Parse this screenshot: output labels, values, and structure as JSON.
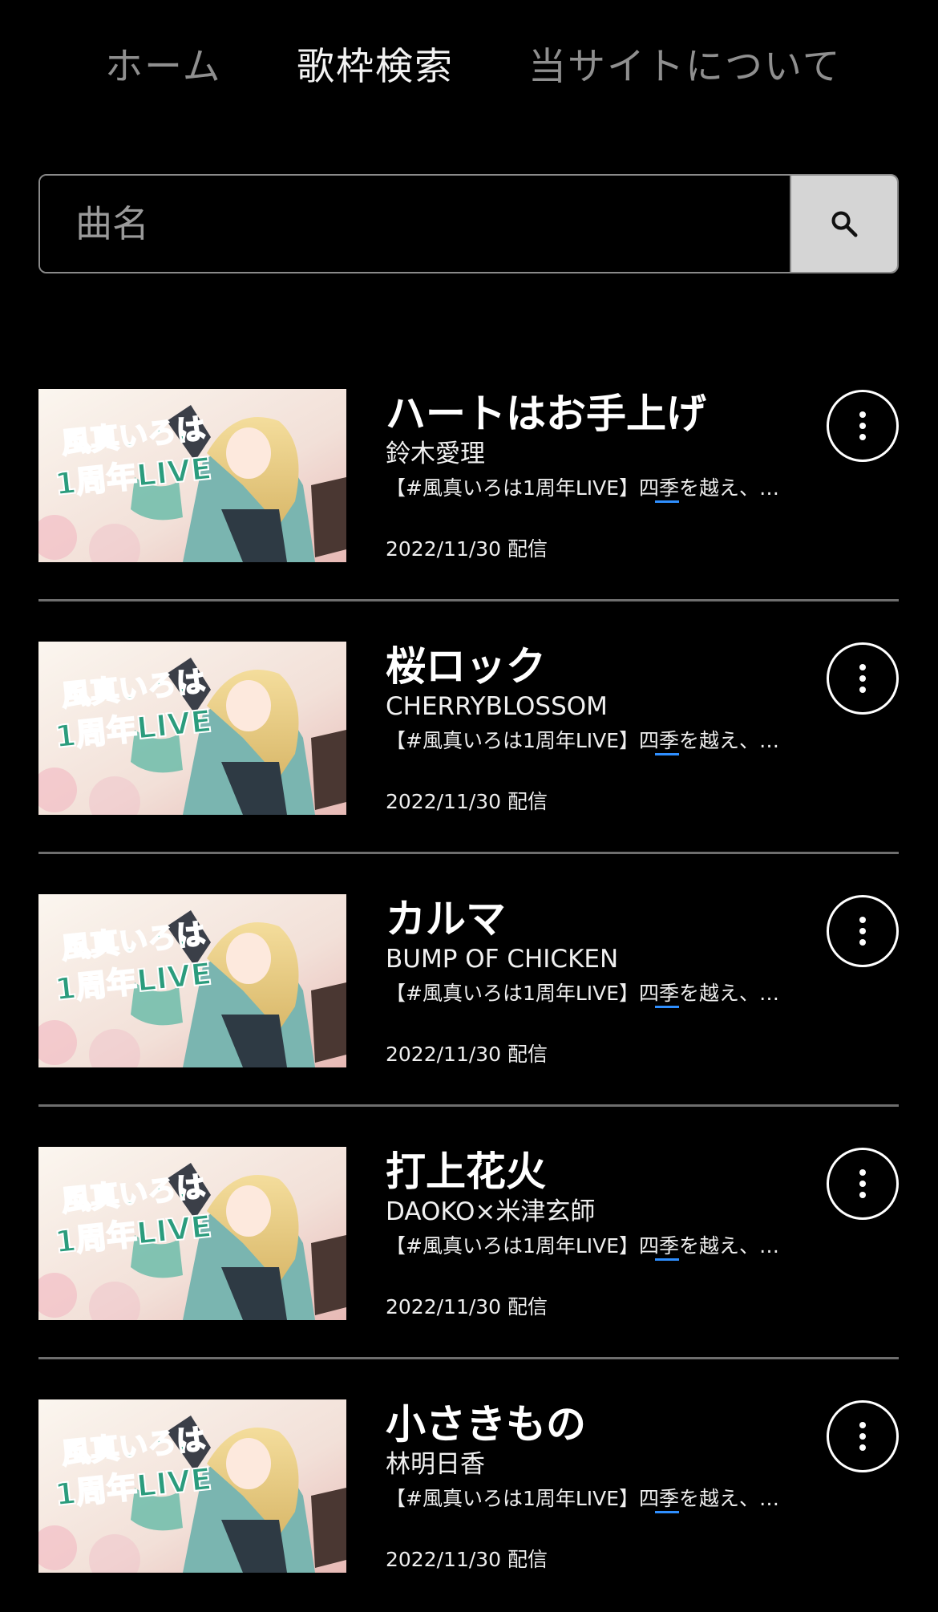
{
  "nav": {
    "home": "ホーム",
    "search": "歌枠検索",
    "about": "当サイトについて"
  },
  "search": {
    "placeholder": "曲名",
    "value": "",
    "button_icon": "search-icon"
  },
  "thumbnail": {
    "text_line1": "風真いろは",
    "text_line2": "1周年LIVE"
  },
  "results": [
    {
      "title": "ハートはお手上げ",
      "artist": "鈴木愛理",
      "stream": "【#風真いろは1周年LIVE】四季を越え、…",
      "date": "2022/11/30 配信"
    },
    {
      "title": "桜ロック",
      "artist": "CHERRYBLOSSOM",
      "stream": "【#風真いろは1周年LIVE】四季を越え、…",
      "date": "2022/11/30 配信"
    },
    {
      "title": "カルマ",
      "artist": "BUMP OF CHICKEN",
      "stream": "【#風真いろは1周年LIVE】四季を越え、…",
      "date": "2022/11/30 配信"
    },
    {
      "title": "打上花火",
      "artist": "DAOKO×米津玄師",
      "stream": "【#風真いろは1周年LIVE】四季を越え、…",
      "date": "2022/11/30 配信"
    },
    {
      "title": "小さきもの",
      "artist": "林明日香",
      "stream": "【#風真いろは1周年LIVE】四季を越え、…",
      "date": "2022/11/30 配信"
    }
  ]
}
